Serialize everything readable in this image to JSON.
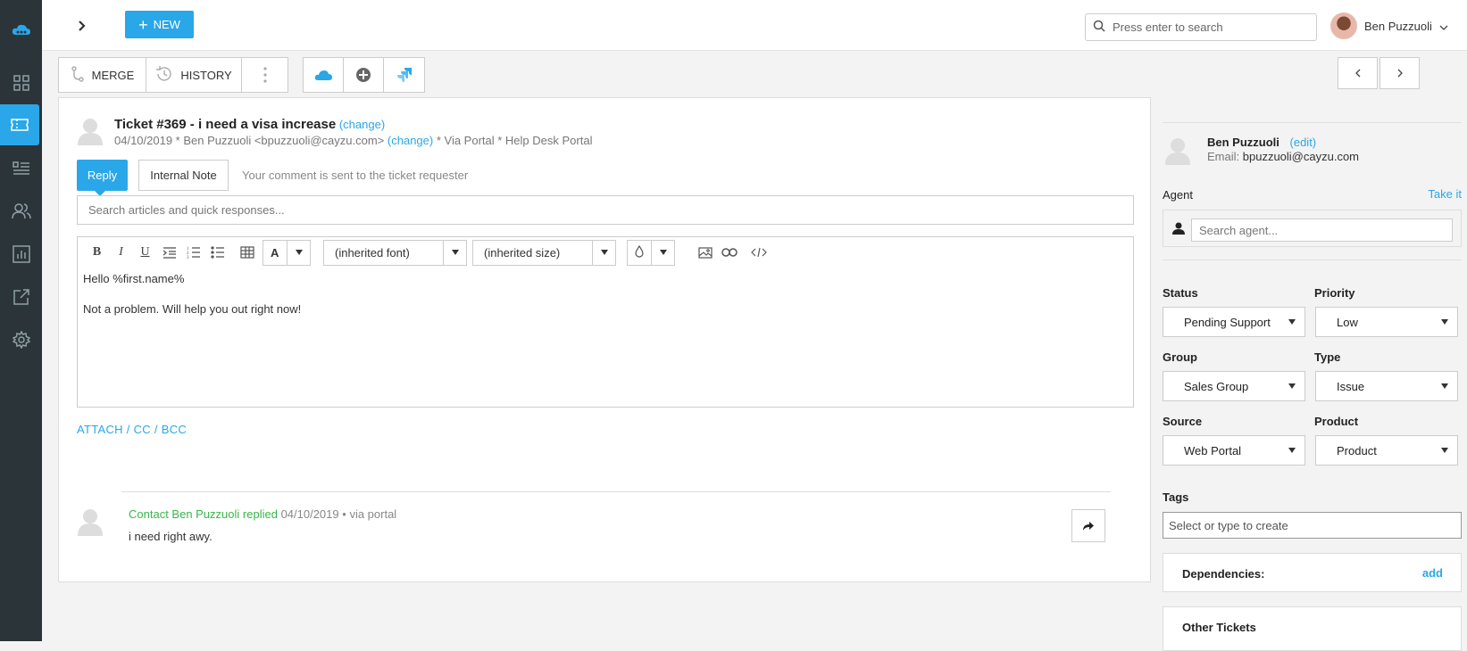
{
  "sidebar": {
    "logo_icon": "cloud-logo-icon",
    "items": [
      {
        "icon": "dashboard-icon",
        "active": false
      },
      {
        "icon": "ticket-icon",
        "active": true
      },
      {
        "icon": "knowledge-list-icon",
        "active": false
      },
      {
        "icon": "users-icon",
        "active": false
      },
      {
        "icon": "reports-icon",
        "active": false
      },
      {
        "icon": "external-link-icon",
        "active": false
      },
      {
        "icon": "settings-gear-icon",
        "active": false
      }
    ]
  },
  "topbar": {
    "new_label": "NEW",
    "search_placeholder": "Press enter to search",
    "user_name": "Ben Puzzuoli"
  },
  "toolbar": {
    "merge_label": "MERGE",
    "history_label": "HISTORY"
  },
  "ticket": {
    "title": "Ticket #369 - i need a visa increase",
    "change_label": "(change)",
    "sub_prefix": "04/10/2019 * Ben Puzzuoli <bpuzzuoli@cayzu.com>",
    "sub_change": "(change)",
    "sub_suffix": "* Via Portal * Help Desk Portal"
  },
  "reply": {
    "tab_reply": "Reply",
    "tab_internal": "Internal Note",
    "hint": "Your comment is sent to the ticket requester",
    "article_search_placeholder": "Search articles and quick responses...",
    "font_select": "(inherited font)",
    "size_select": "(inherited size)",
    "body_line1": "Hello %first.name%",
    "body_line2": "Not a problem.  Will help you out right now!",
    "attach_label": "ATTACH / CC / BCC"
  },
  "history_entry": {
    "author": "Contact Ben Puzzuoli replied",
    "date": "04/10/2019",
    "via": "via portal",
    "text": "i need right awy."
  },
  "contact": {
    "name": "Ben Puzzuoli",
    "edit_label": "(edit)",
    "email_label": "Email:",
    "email": "bpuzzuoli@cayzu.com"
  },
  "agent": {
    "label": "Agent",
    "take_it": "Take it",
    "search_placeholder": "Search agent..."
  },
  "fields": {
    "status_label": "Status",
    "status_value": "Pending Support",
    "priority_label": "Priority",
    "priority_value": "Low",
    "group_label": "Group",
    "group_value": "Sales Group",
    "type_label": "Type",
    "type_value": "Issue",
    "source_label": "Source",
    "source_value": "Web Portal",
    "product_label": "Product",
    "product_value": "Product",
    "tags_label": "Tags",
    "tags_placeholder": "Select or type to create"
  },
  "dependencies": {
    "label": "Dependencies:",
    "add_label": "add"
  },
  "other_tickets": {
    "label": "Other Tickets"
  },
  "colors": {
    "accent": "#2aa7e8",
    "sidebar": "#2b3438",
    "green": "#3ab54a"
  }
}
